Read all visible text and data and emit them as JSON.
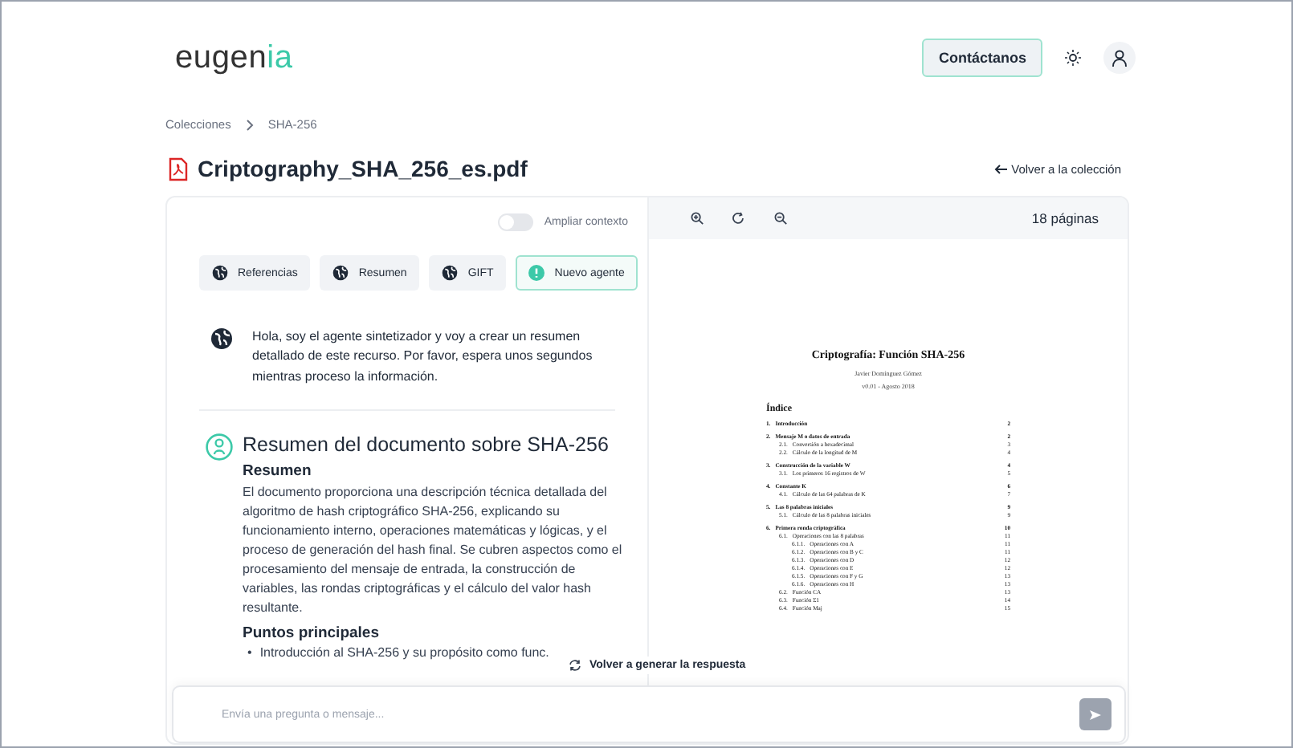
{
  "header": {
    "logo": {
      "main": "eugen",
      "accent": "ia"
    },
    "contact_button": "Contáctanos"
  },
  "breadcrumb": [
    "Colecciones",
    "SHA-256"
  ],
  "document": {
    "title": "Criptography_SHA_256_es.pdf",
    "back_link": "Volver a la colección"
  },
  "context_toggle": {
    "label": "Ampliar contexto",
    "on": false
  },
  "agents": [
    {
      "label": "Referencias",
      "kind": "globe",
      "selected": false
    },
    {
      "label": "Resumen",
      "kind": "globe",
      "selected": false
    },
    {
      "label": "GIFT",
      "kind": "globe",
      "selected": false
    },
    {
      "label": "Nuevo agente",
      "kind": "new",
      "selected": true
    }
  ],
  "intro_message": "Hola, soy el agente sintetizador y voy a crear un resumen detallado de este recurso. Por favor, espera unos segundos mientras proceso la información.",
  "summary": {
    "title": "Resumen del documento sobre SHA-256",
    "heading": "Resumen",
    "paragraph": "El documento proporciona una descripción técnica detallada del algoritmo de hash criptográfico SHA-256, explicando su funcionamiento interno, operaciones matemáticas y lógicas, y el proceso de generación del hash final. Se cubren aspectos como el procesamiento del mensaje de entrada, la construcción de variables, las rondas criptográficas y el cálculo del valor hash resultante.",
    "subheading": "Puntos principales",
    "bullets": [
      {
        "marker": "•",
        "text": "Introducción al SHA-256 y su propósito como func."
      }
    ]
  },
  "regenerate_button": "Volver a generar la respuesta",
  "chat_input": {
    "placeholder": "Envía una pregunta o mensaje..."
  },
  "viewer": {
    "page_count": "18 páginas",
    "page": {
      "title": "Criptografía: Función SHA-256",
      "author": "Javier Domínguez Gómez",
      "version": "v0.01 - Agosto 2018",
      "toc_title": "Índice",
      "toc": [
        {
          "num": "1.",
          "text": "Introducción",
          "page": "2"
        },
        {
          "num": "2.",
          "text": "Mensaje M o datos de entrada",
          "page": "2",
          "children": [
            {
              "num": "2.1.",
              "text": "Conversión a hexadecimal",
              "page": "3"
            },
            {
              "num": "2.2.",
              "text": "Cálculo de la longitud de M",
              "page": "4"
            }
          ]
        },
        {
          "num": "3.",
          "text": "Construcción de la variable W",
          "page": "4",
          "children": [
            {
              "num": "3.1.",
              "text": "Los primeros 16 registros de W",
              "page": "5"
            }
          ]
        },
        {
          "num": "4.",
          "text": "Constante K",
          "page": "6",
          "children": [
            {
              "num": "4.1.",
              "text": "Cálculo de las 64 palabras de K",
              "page": "7"
            }
          ]
        },
        {
          "num": "5.",
          "text": "Las 8 palabras iniciales",
          "page": "9",
          "children": [
            {
              "num": "5.1.",
              "text": "Cálculo de las 8 palabras iniciales",
              "page": "9"
            }
          ]
        },
        {
          "num": "6.",
          "text": "Primera ronda criptográfica",
          "page": "10",
          "children": [
            {
              "num": "6.1.",
              "text": "Operaciones con las 8 palabras",
              "page": "11",
              "children": [
                {
                  "num": "6.1.1.",
                  "text": "Operaciones con A",
                  "page": "11"
                },
                {
                  "num": "6.1.2.",
                  "text": "Operaciones con B y C",
                  "page": "11"
                },
                {
                  "num": "6.1.3.",
                  "text": "Operaciones con D",
                  "page": "12"
                },
                {
                  "num": "6.1.4.",
                  "text": "Operaciones con E",
                  "page": "12"
                },
                {
                  "num": "6.1.5.",
                  "text": "Operaciones con F y G",
                  "page": "13"
                },
                {
                  "num": "6.1.6.",
                  "text": "Operaciones con H",
                  "page": "13"
                }
              ]
            },
            {
              "num": "6.2.",
              "text": "Función CA",
              "page": "13"
            },
            {
              "num": "6.3.",
              "text": "Función Σ1",
              "page": "14"
            },
            {
              "num": "6.4.",
              "text": "Función Maj",
              "page": "15"
            }
          ]
        }
      ]
    }
  }
}
